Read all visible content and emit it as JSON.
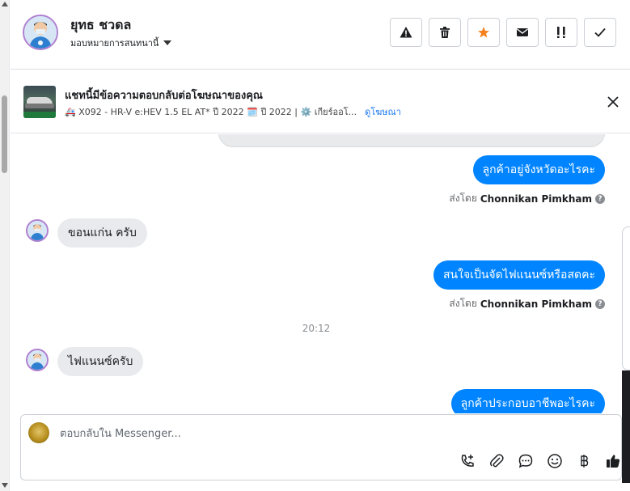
{
  "header": {
    "user_name": "ยุทธ ชวดล",
    "assign_label": "มอบหมายการสนทนานี้",
    "actions": [
      {
        "name": "spam",
        "icon": "warning-icon"
      },
      {
        "name": "delete",
        "icon": "trash-icon"
      },
      {
        "name": "star",
        "icon": "star-icon"
      },
      {
        "name": "mark-unread",
        "icon": "envelope-icon"
      },
      {
        "name": "follow-up",
        "icon": "follow-up-icon"
      },
      {
        "name": "done",
        "icon": "check-icon"
      }
    ]
  },
  "ad_banner": {
    "title": "แชทนี้มีข้อความตอบกลับต่อโฆษณาของคุณ",
    "detail": "🚑 X092 - HR-V e:HEV 1.5 EL AT* ปี 2022 🗓️ ปี 2022 | ⚙️ เกียร์ออโ...",
    "link": "ดูโฆษณา"
  },
  "chat": {
    "messages": [
      {
        "direction": "out",
        "text": "ลูกค้าอยู่จังหวัดอะไรคะ"
      },
      {
        "direction": "meta",
        "sent_by_label": "ส่งโดย",
        "sender": "Chonnikan Pimkham"
      },
      {
        "direction": "in",
        "text": "ขอนแก่น ครับ"
      },
      {
        "direction": "out",
        "text": "สนใจเป็นจัดไฟแนนซ์หรือสดคะ"
      },
      {
        "direction": "meta",
        "sent_by_label": "ส่งโดย",
        "sender": "Chonnikan Pimkham"
      },
      {
        "direction": "time",
        "text": "20:12"
      },
      {
        "direction": "in",
        "text": "ไฟแนนซ์ครับ"
      },
      {
        "direction": "out",
        "text": "ลูกค้าประกอบอาชีพอะไรคะ"
      }
    ]
  },
  "composer": {
    "placeholder": "ตอบกลับใน Messenger...",
    "tools": [
      "call-add-icon",
      "attachment-icon",
      "chat-bubble-icon",
      "emoji-icon",
      "baht-icon",
      "thumbs-up-icon"
    ]
  },
  "colors": {
    "accent": "#0084ff",
    "incoming_bubble": "#e9eaed",
    "star": "#f5821f"
  }
}
